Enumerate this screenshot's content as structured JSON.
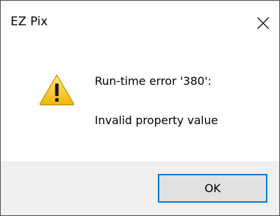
{
  "window": {
    "title": "EZ Pix",
    "close_icon": "close-icon"
  },
  "message": {
    "icon": "warning-icon",
    "line1": "Run-time error '380':",
    "line2": "Invalid property value"
  },
  "buttons": {
    "ok_label": "OK"
  },
  "colors": {
    "accent": "#0078d7",
    "footer_bg": "#f0f0f0",
    "button_bg": "#e1e1e1",
    "warning_fill": "#f9c623"
  }
}
